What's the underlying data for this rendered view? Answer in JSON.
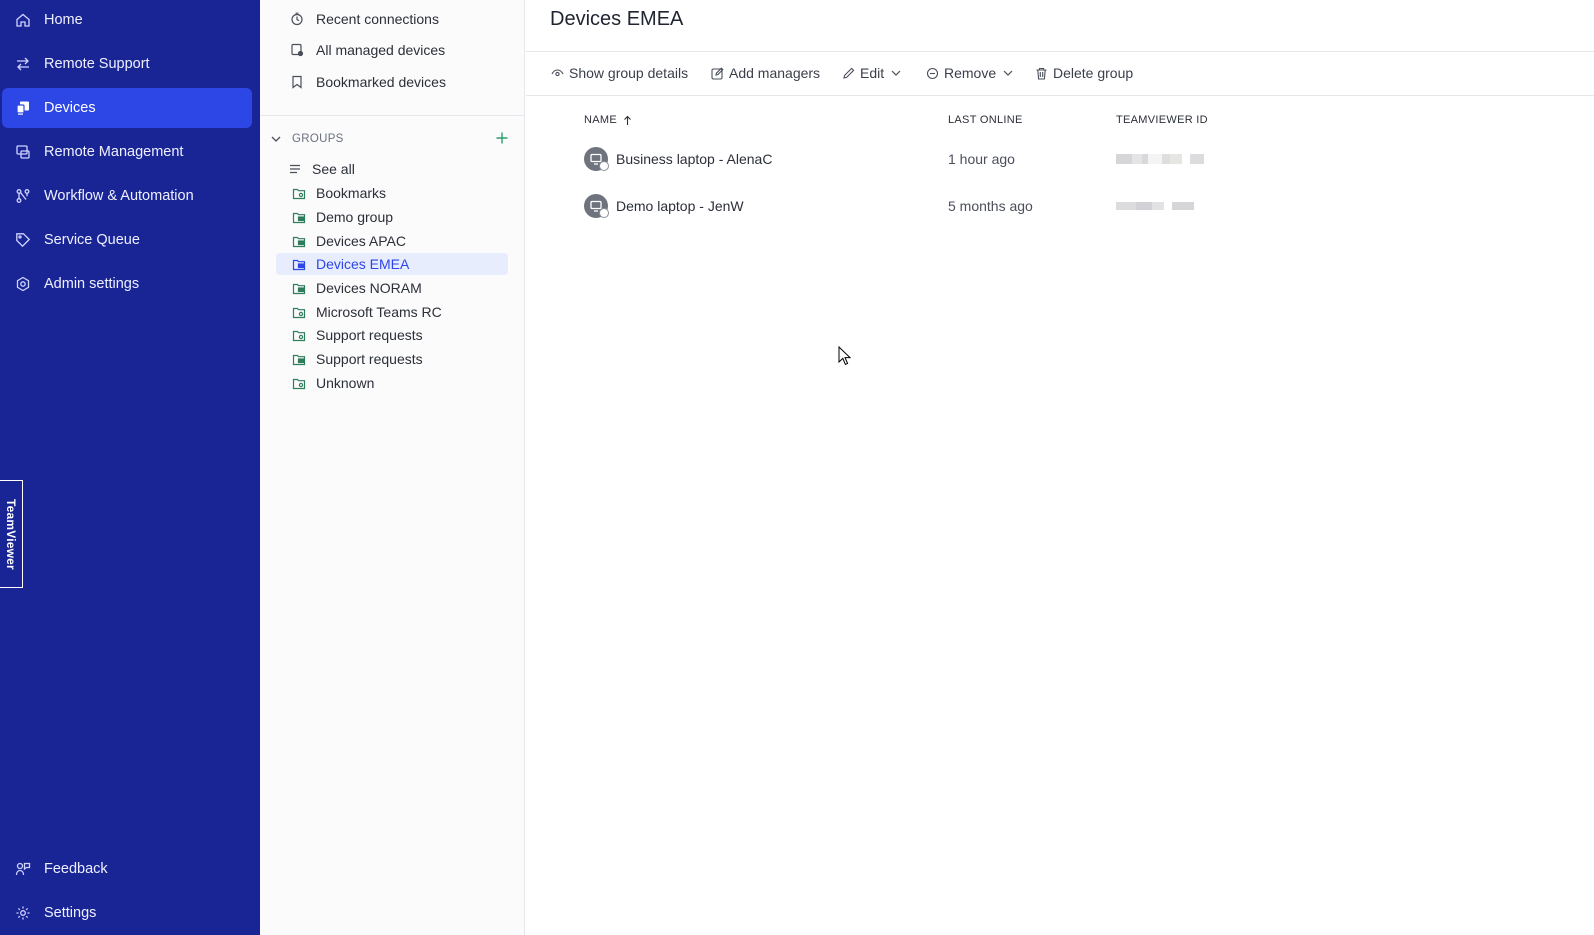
{
  "nav": {
    "items": [
      {
        "label": "Home",
        "icon": "home-icon"
      },
      {
        "label": "Remote Support",
        "icon": "arrows-icon"
      },
      {
        "label": "Devices",
        "icon": "devices-icon"
      },
      {
        "label": "Remote Management",
        "icon": "remote-management-icon"
      },
      {
        "label": "Workflow & Automation",
        "icon": "workflow-icon"
      },
      {
        "label": "Service Queue",
        "icon": "tag-icon"
      },
      {
        "label": "Admin settings",
        "icon": "admin-gear-icon"
      }
    ],
    "bottom": [
      {
        "label": "Feedback",
        "icon": "feedback-icon"
      },
      {
        "label": "Settings",
        "icon": "gear-icon"
      }
    ],
    "brand_tab": "TeamViewer",
    "accent": "#2d46e6",
    "background": "#1a2595"
  },
  "panel": {
    "quick_links": [
      {
        "label": "Recent connections",
        "icon": "clock-icon"
      },
      {
        "label": "All managed devices",
        "icon": "managed-device-icon"
      },
      {
        "label": "Bookmarked devices",
        "icon": "bookmark-icon"
      }
    ],
    "groups_header": "GROUPS",
    "groups": [
      {
        "label": "See all",
        "icon": "list-icon"
      },
      {
        "label": "Bookmarks",
        "icon": "group-shared-icon"
      },
      {
        "label": "Demo group",
        "icon": "group-icon"
      },
      {
        "label": "Devices APAC",
        "icon": "group-icon"
      },
      {
        "label": "Devices EMEA",
        "icon": "group-icon"
      },
      {
        "label": "Devices NORAM",
        "icon": "group-icon"
      },
      {
        "label": "Microsoft Teams RC",
        "icon": "group-shared-icon"
      },
      {
        "label": "Support requests",
        "icon": "group-shared-icon"
      },
      {
        "label": "Support requests",
        "icon": "group-icon"
      },
      {
        "label": "Unknown",
        "icon": "group-shared-icon"
      }
    ]
  },
  "main": {
    "title": "Devices EMEA",
    "toolbar": {
      "show_details": "Show group details",
      "add_managers": "Add managers",
      "edit": "Edit",
      "remove": "Remove",
      "delete_group": "Delete group"
    },
    "table": {
      "columns": [
        "NAME",
        "LAST ONLINE",
        "TEAMVIEWER ID"
      ],
      "sort": "ascending",
      "rows": [
        {
          "name": "Business laptop - AlenaC",
          "last_online": "1 hour ago"
        },
        {
          "name": "Demo laptop - JenW",
          "last_online": "5 months ago"
        }
      ]
    }
  }
}
